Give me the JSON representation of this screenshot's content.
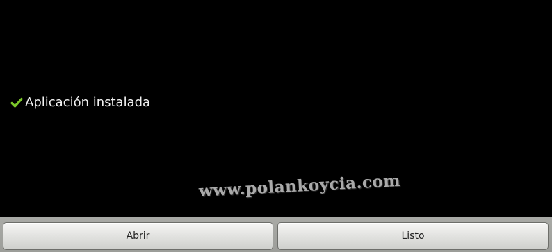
{
  "status": {
    "icon": "checkmark-icon",
    "icon_color": "#7cc72a",
    "text": "Aplicación instalada"
  },
  "watermark": {
    "text": "www.polankoycia.com"
  },
  "buttons": {
    "open_label": "Abrir",
    "done_label": "Listo"
  }
}
